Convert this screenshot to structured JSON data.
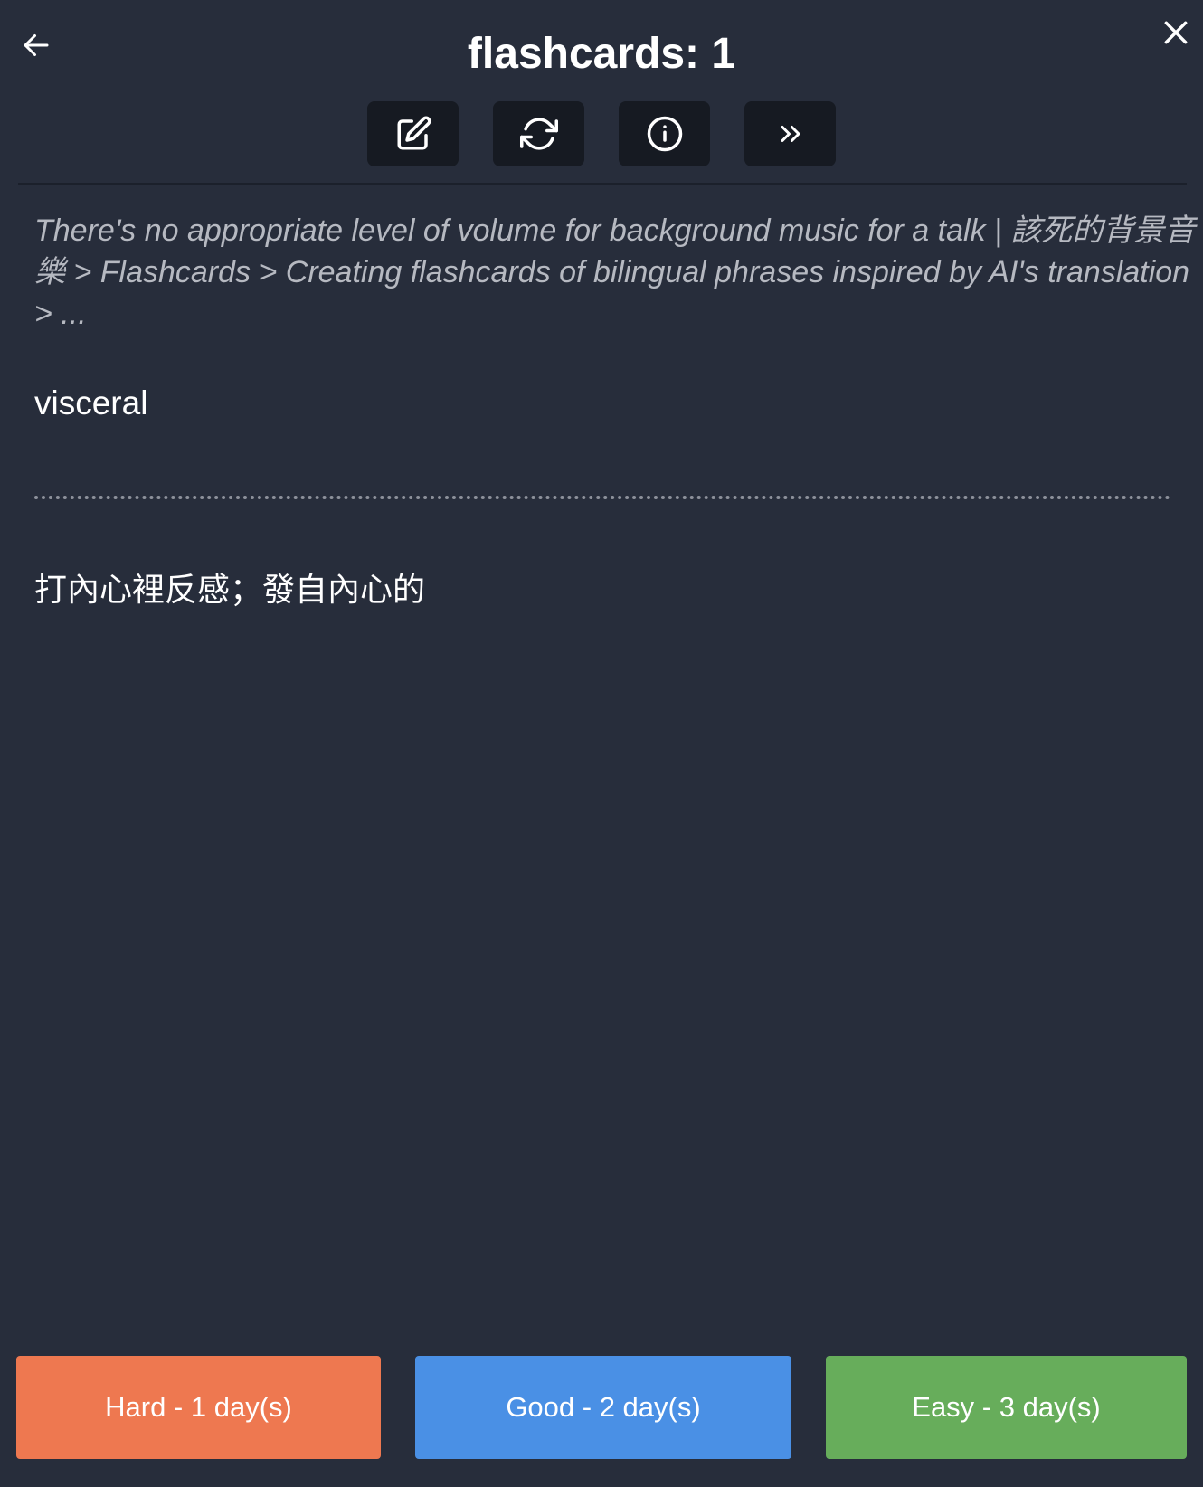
{
  "header": {
    "title": "flashcards: 1",
    "back_icon": "arrow-left-icon",
    "close_icon": "close-icon"
  },
  "toolbar": {
    "buttons": [
      {
        "icon": "edit-icon"
      },
      {
        "icon": "refresh-icon"
      },
      {
        "icon": "info-icon"
      },
      {
        "icon": "skip-forward-icon"
      }
    ]
  },
  "card": {
    "breadcrumb": "There's no appropriate level of volume for background music for a talk | 該死的背景音樂 > Flashcards > Creating flashcards of bilingual phrases inspired by AI's translation > ...",
    "front": "visceral",
    "back": "打內心裡反感；發自內心的"
  },
  "answers": {
    "hard": "Hard - 1 day(s)",
    "good": "Good - 2 day(s)",
    "easy": "Easy - 3 day(s)"
  },
  "colors": {
    "background": "#272d3b",
    "toolbar_button": "#161a22",
    "hard": "#ee7850",
    "good": "#4a90e5",
    "easy": "#67ad5b",
    "breadcrumb_text": "#b6b9c1"
  }
}
